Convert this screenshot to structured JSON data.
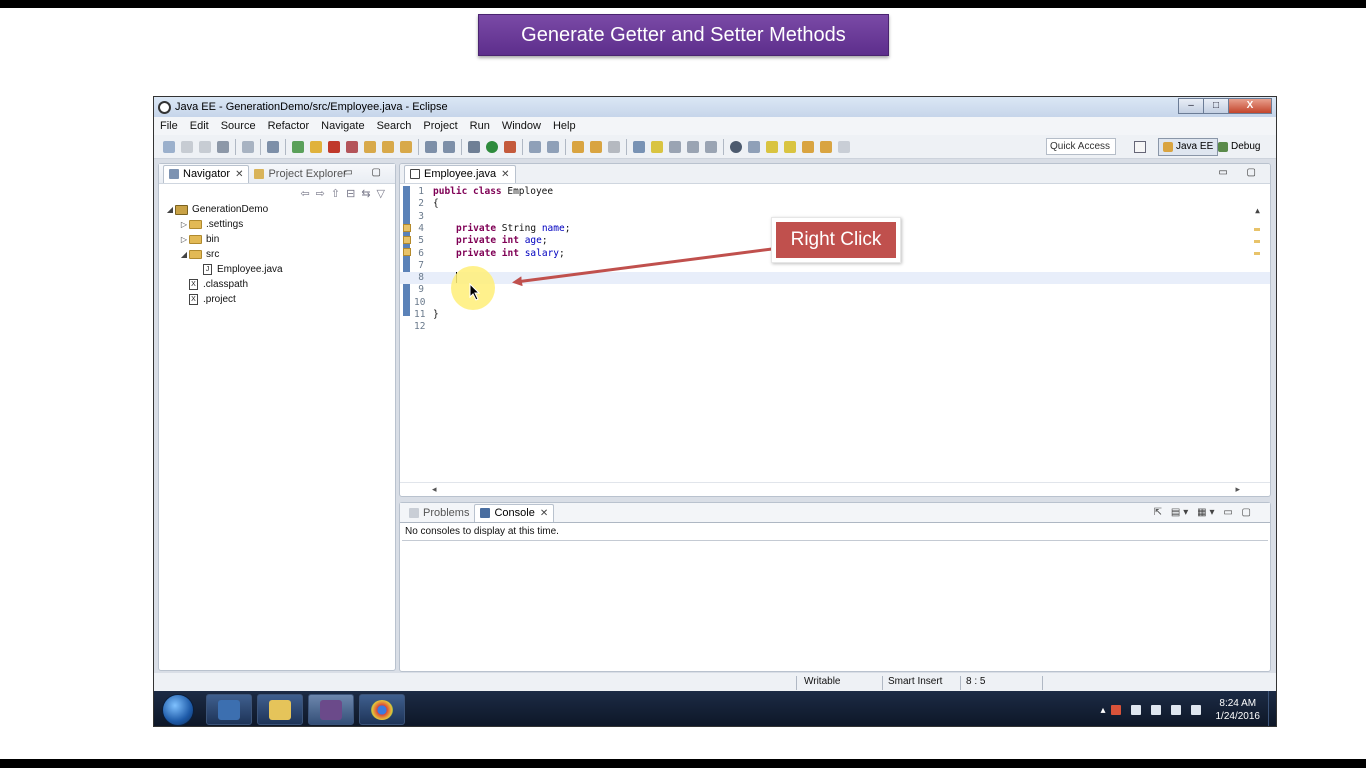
{
  "banner": {
    "title": "Generate Getter and Setter Methods"
  },
  "window": {
    "title": "Java EE - GenerationDemo/src/Employee.java - Eclipse",
    "controls": {
      "minimize": "–",
      "maximize": "□",
      "close": "X"
    }
  },
  "menu": [
    "File",
    "Edit",
    "Source",
    "Refactor",
    "Navigate",
    "Search",
    "Project",
    "Run",
    "Window",
    "Help"
  ],
  "toolbar": {
    "quick_access": "Quick Access",
    "perspectives": {
      "java_ee": "Java EE",
      "debug": "Debug"
    }
  },
  "navigator": {
    "tabs": {
      "navigator": "Navigator",
      "project_explorer": "Project Explorer"
    },
    "tree": {
      "project": "GenerationDemo",
      "settings": ".settings",
      "bin": "bin",
      "src": "src",
      "employee": "Employee.java",
      "classpath": ".classpath",
      "project_file": ".project"
    }
  },
  "editor": {
    "tab": "Employee.java",
    "lines": [
      "1",
      "2",
      "3",
      "4",
      "5",
      "6",
      "7",
      "8",
      "9",
      "10",
      "11",
      "12"
    ],
    "code": {
      "l1_kw": "public class",
      "l1_name": " Employee",
      "l2": "{",
      "private": "private",
      "l4_type": " String ",
      "l4_field": "name",
      "l5_type": "int",
      "l5_field": "age",
      "l6_field": "salary",
      "semicolon": ";",
      "l11": "}"
    }
  },
  "console": {
    "tabs": {
      "problems": "Problems",
      "console": "Console"
    },
    "message": "No consoles to display at this time."
  },
  "status": {
    "writable": "Writable",
    "insert_mode": "Smart Insert",
    "position": "8 : 5"
  },
  "taskbar": {
    "time": "8:24 AM",
    "date": "1/24/2016"
  },
  "annotation": {
    "label": "Right Click"
  },
  "colors": {
    "banner": "#5d2e8c",
    "callout": "#c0504d",
    "keyword": "#7f0055",
    "field": "#0000c0"
  }
}
